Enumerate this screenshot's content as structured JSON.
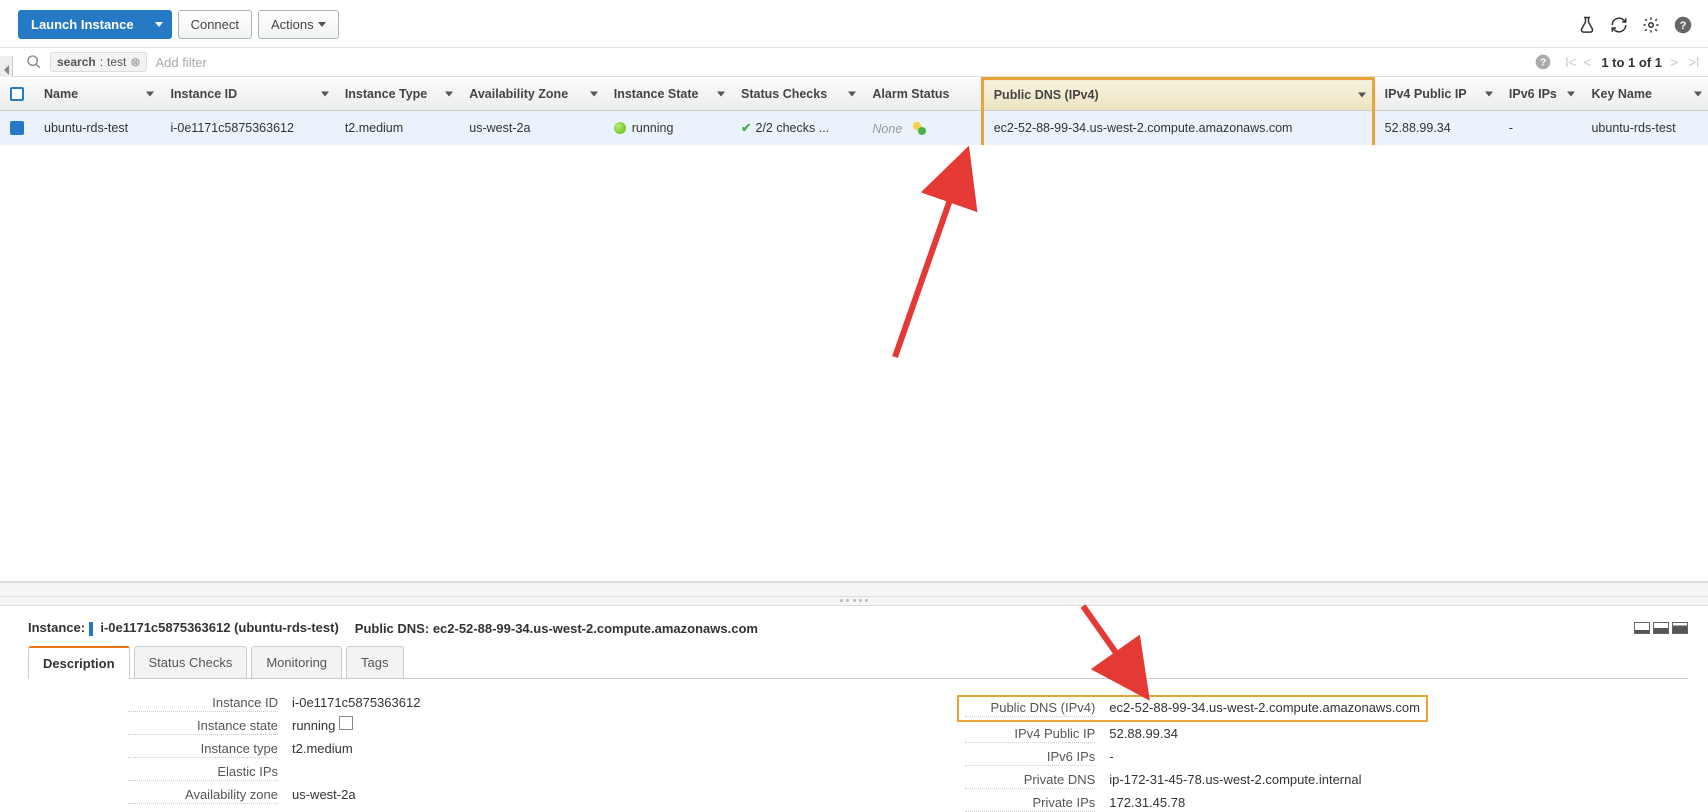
{
  "toolbar": {
    "launch_label": "Launch Instance",
    "connect_label": "Connect",
    "actions_label": "Actions"
  },
  "filter": {
    "chip_key": "search",
    "chip_value": "test",
    "add_filter_placeholder": "Add filter",
    "pager_text": "1 to 1 of 1"
  },
  "columns": {
    "name": "Name",
    "instance_id": "Instance ID",
    "instance_type": "Instance Type",
    "az": "Availability Zone",
    "state": "Instance State",
    "status_checks": "Status Checks",
    "alarm_status": "Alarm Status",
    "public_dns": "Public DNS (IPv4)",
    "public_ip": "IPv4 Public IP",
    "ipv6": "IPv6 IPs",
    "key_name": "Key Name"
  },
  "row": {
    "name": "ubuntu-rds-test",
    "instance_id": "i-0e1171c5875363612",
    "instance_type": "t2.medium",
    "az": "us-west-2a",
    "state": "running",
    "status_checks": "2/2 checks ...",
    "alarm_status": "None",
    "public_dns": "ec2-52-88-99-34.us-west-2.compute.amazonaws.com",
    "public_ip": "52.88.99.34",
    "ipv6": "-",
    "key_name": "ubuntu-rds-test"
  },
  "details": {
    "header_label": "Instance:",
    "header_id": "i-0e1171c5875363612 (ubuntu-rds-test)",
    "header_dns_label": "Public DNS:",
    "header_dns": "ec2-52-88-99-34.us-west-2.compute.amazonaws.com",
    "tabs": {
      "description": "Description",
      "status_checks": "Status Checks",
      "monitoring": "Monitoring",
      "tags": "Tags"
    },
    "left": {
      "instance_id_k": "Instance ID",
      "instance_id_v": "i-0e1171c5875363612",
      "instance_state_k": "Instance state",
      "instance_state_v": "running",
      "instance_type_k": "Instance type",
      "instance_type_v": "t2.medium",
      "elastic_ips_k": "Elastic IPs",
      "elastic_ips_v": "",
      "az_k": "Availability zone",
      "az_v": "us-west-2a"
    },
    "right": {
      "public_dns_k": "Public DNS (IPv4)",
      "public_dns_v": "ec2-52-88-99-34.us-west-2.compute.amazonaws.com",
      "public_ip_k": "IPv4 Public IP",
      "public_ip_v": "52.88.99.34",
      "ipv6_k": "IPv6 IPs",
      "ipv6_v": "-",
      "private_dns_k": "Private DNS",
      "private_dns_v": "ip-172-31-45-78.us-west-2.compute.internal",
      "private_ips_k": "Private IPs",
      "private_ips_v": "172.31.45.78"
    }
  }
}
